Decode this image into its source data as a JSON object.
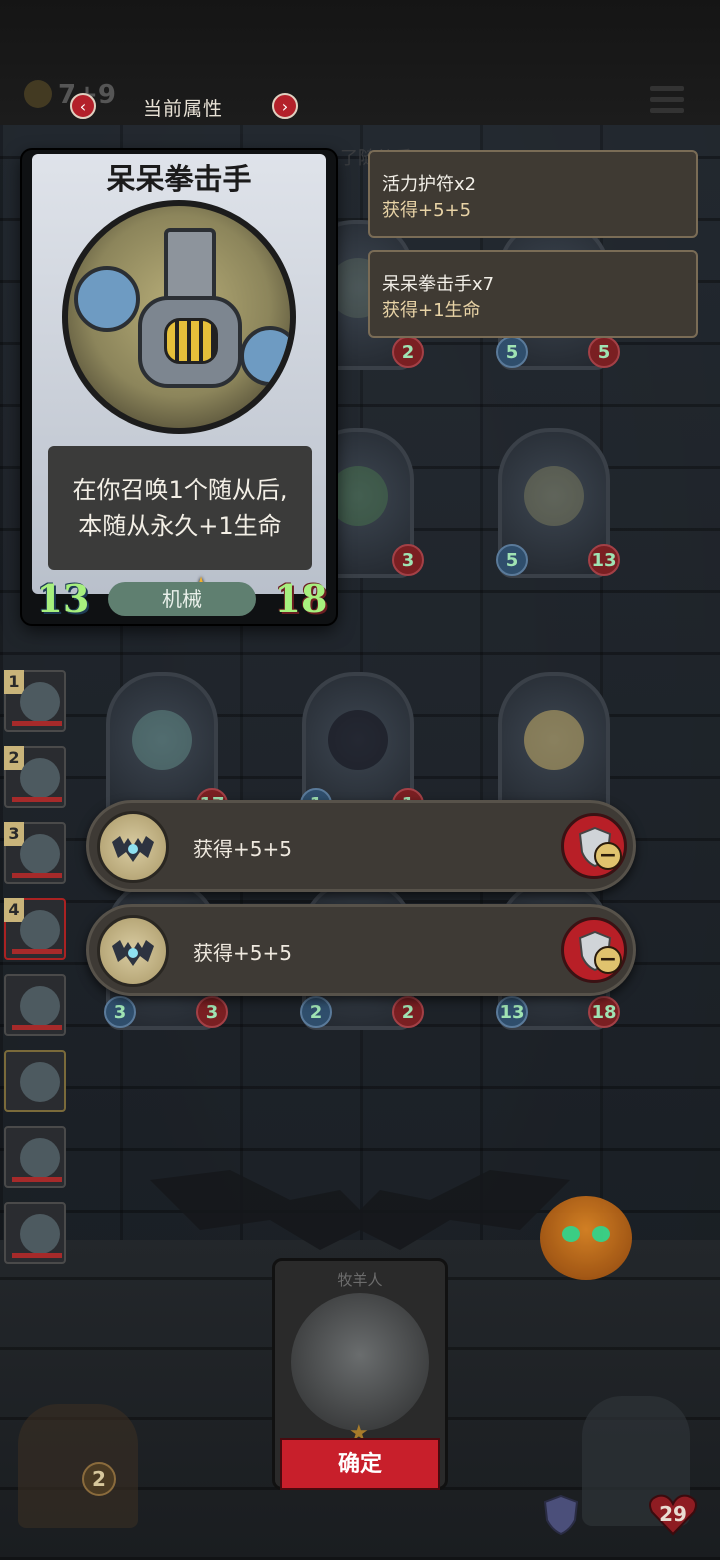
{
  "header": {
    "coins": "7+9",
    "title": "当前属性",
    "prev_label": "‹",
    "next_label": "›"
  },
  "background_text": "了随从后",
  "selected_card": {
    "name": "呆呆拳击手",
    "description_line1": "在你召唤1个随从后,",
    "description_line2": "本随从永久+1生命",
    "type": "机械",
    "attack": "13",
    "health": "18"
  },
  "buffs": [
    {
      "source": "活力护符x2",
      "effect": "获得+5+5"
    },
    {
      "source": "呆呆拳击手x7",
      "effect": "获得+1生命"
    }
  ],
  "board": {
    "row1": [
      {
        "atk": "",
        "hp": "2"
      },
      {
        "atk": "5",
        "hp": "5"
      }
    ],
    "row2": [
      {
        "atk": "",
        "hp": "3"
      },
      {
        "atk": "5",
        "hp": "13"
      }
    ],
    "row3": [
      {
        "atk": "",
        "hp": "17"
      },
      {
        "atk": "1",
        "hp": "1"
      },
      {
        "atk": "",
        "hp": ""
      }
    ],
    "row4": [
      {
        "atk": "3",
        "hp": "3"
      },
      {
        "atk": "2",
        "hp": "2"
      },
      {
        "atk": "13",
        "hp": "18"
      }
    ]
  },
  "hero_list": [
    "1",
    "2",
    "3",
    "4",
    "",
    "",
    "",
    ""
  ],
  "popup_items": [
    {
      "text": "获得+5+5",
      "icon": "bat-amulet-icon",
      "remove_icon": "shield-minus-icon"
    },
    {
      "text": "获得+5+5",
      "icon": "bat-amulet-icon",
      "remove_icon": "shield-minus-icon"
    }
  ],
  "bottom_card": {
    "name": "牧羊人",
    "confirm_label": "确定"
  },
  "chest_count": "2",
  "player_health": "29",
  "colors": {
    "confirm": "#c81f2b",
    "stat_text": "#a7f07e",
    "panel_border": "#7a6c56"
  }
}
